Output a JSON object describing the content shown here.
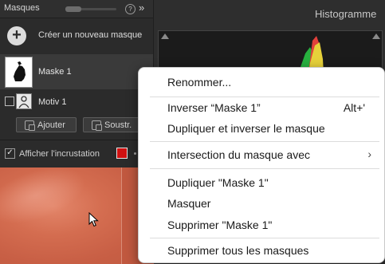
{
  "masks_panel": {
    "title": "Masques",
    "collapse_glyph": "»",
    "help_glyph": "?",
    "create_label": "Créer un nouveau masque",
    "mask_name": "Maske 1",
    "subject_name": "Motiv 1",
    "add_label": "Ajouter",
    "subtract_label": "Soustr.",
    "overlay_label": "Afficher l'incrustation",
    "overlay_checked": true,
    "overlay_color": "#d01111"
  },
  "histogram": {
    "title": "Histogramme"
  },
  "context_menu": {
    "items": [
      {
        "label": "Renommer..."
      },
      {
        "label": "Inverser “Maske 1”",
        "shortcut": "Alt+'"
      },
      {
        "label": "Dupliquer et inverser le masque"
      },
      {
        "label": "Intersection du masque avec",
        "submenu": true
      },
      {
        "label": "Dupliquer \"Maske 1\""
      },
      {
        "label": "Masquer"
      },
      {
        "label": "Supprimer \"Maske 1\""
      },
      {
        "label": "Supprimer tous les masques"
      }
    ],
    "submenu_glyph": "›"
  },
  "icons": {
    "add": "plus-circle-icon",
    "help": "help-icon",
    "collapse": "double-chevron-icon",
    "cursor": "mouse-pointer-icon"
  }
}
